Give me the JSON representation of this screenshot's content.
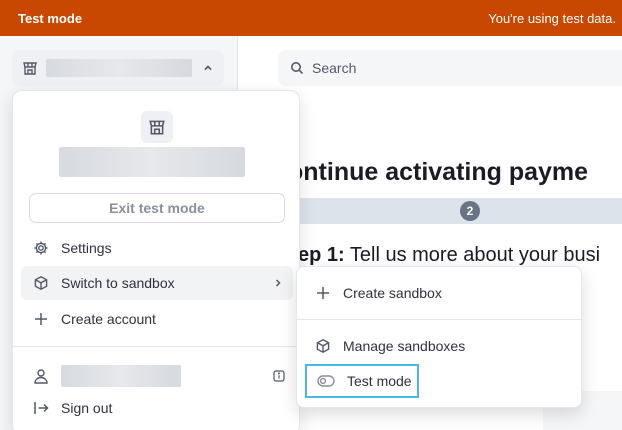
{
  "banner": {
    "title": "Test mode",
    "message": "You're using test data.",
    "color": "#c84801"
  },
  "sidebar": {
    "account_switcher": {
      "icon": "store-icon",
      "toggle_icon": "chevron-up-icon"
    }
  },
  "main": {
    "search": {
      "placeholder": "Search",
      "icon": "search-icon"
    },
    "headline": "ontinue activating payme",
    "progress": {
      "current_step": "2"
    },
    "step": {
      "label": "ep 1:",
      "text": " Tell us more about your busi"
    }
  },
  "account_menu": {
    "exit_test_mode_label": "Exit test mode",
    "items": [
      {
        "label": "Settings",
        "icon": "gear-icon"
      },
      {
        "label": "Switch to sandbox",
        "icon": "cube-icon"
      },
      {
        "label": "Create account",
        "icon": "plus-icon"
      }
    ],
    "sign_out_label": "Sign out",
    "sign_out_icon": "sign-out-icon",
    "user_icon": "user-icon",
    "info_icon": "info-icon"
  },
  "sandbox_menu": {
    "items": [
      {
        "label": "Create sandbox",
        "icon": "plus-icon"
      },
      {
        "label": "Manage sandboxes",
        "icon": "cube-icon"
      },
      {
        "label": "Test mode",
        "icon": "toggle-icon"
      }
    ],
    "highlight_color": "#49b8e6"
  }
}
